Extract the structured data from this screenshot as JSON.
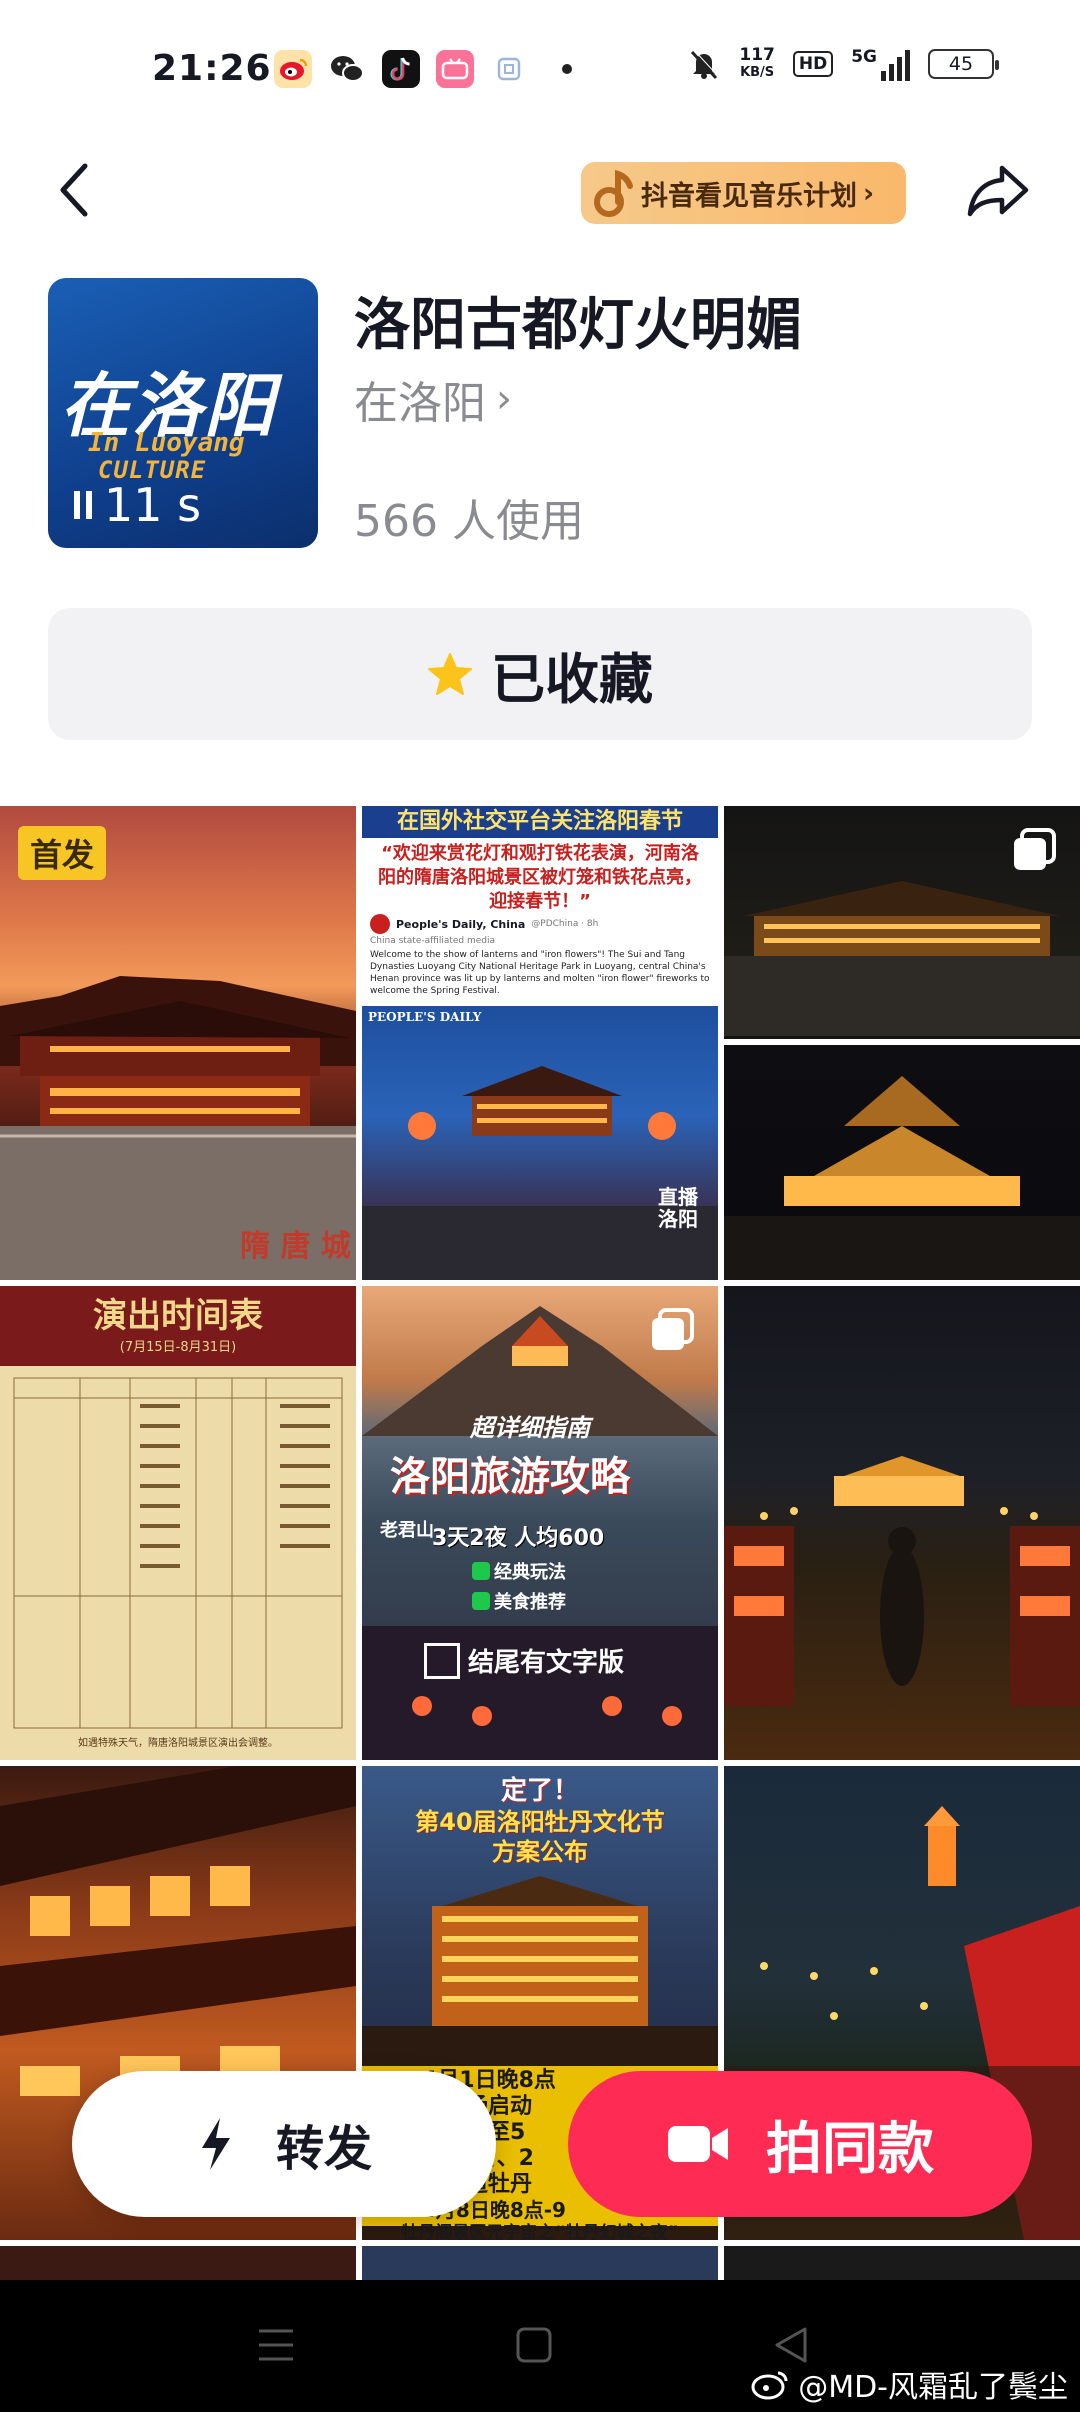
{
  "status_bar": {
    "time": "21:26",
    "net_speed_value": "117",
    "net_speed_unit": "KB/S",
    "hd_label": "HD",
    "network_label": "5G",
    "battery": "45",
    "apps": [
      "weibo-icon",
      "wechat-icon",
      "douyin-icon",
      "bilibili-icon",
      "generic-app-icon"
    ]
  },
  "header": {
    "back_icon": "chevron-left-icon",
    "promo_label": "抖音看见音乐计划",
    "promo_chevron": "›",
    "share_icon": "share-arrow-icon"
  },
  "effect": {
    "cover_main": "在洛阳",
    "cover_sub1": "In Luoyang",
    "cover_sub2": "CULTURE",
    "duration": "11 s",
    "title": "洛阳古都灯火明媚",
    "author": "在洛阳",
    "author_chevron": "›",
    "uses": "566 人使用"
  },
  "favorite": {
    "label": "已收藏",
    "icon": "star-icon",
    "star_color": "#fcc31b"
  },
  "grid": {
    "first_badge": "首发",
    "tiles": [
      {
        "overlay": ""
      },
      {
        "headline": "在国外社交平台关注洛阳春节",
        "quote": "“欢迎来赏花灯和观打铁花表演，河南洛阳的隋唐洛阳城景区被灯笼和铁花点亮，迎接春节！”",
        "source": "People's Daily, China",
        "handle": "@PDChina · 8h",
        "tag": "China state-affiliated media",
        "body": "Welcome to the show of lanterns and \"iron flowers\"! The Sui and Tang Dynasties Luoyang City National Heritage Park in Luoyang, central China's Henan province was lit up by lanterns and molten \"iron flower\" fireworks to welcome the Spring Festival.",
        "logo": "PEOPLE'S DAILY",
        "corner": "直播洛阳"
      },
      {
        "overlay": ""
      },
      {
        "headline": "演出时间表",
        "sub": "(7月15日-8月31日)",
        "footer": "如遇特殊天气，隋唐洛阳城景区演出会调整。"
      },
      {
        "label1": "超详细指南",
        "headline": "洛阳旅游攻略",
        "line1": "3天2夜 人均600",
        "line2": "经典玩法",
        "line3": "美食推荐",
        "line4": "结尾有文字版",
        "tag": "老君山"
      },
      {
        "overlay": ""
      },
      {
        "overlay": ""
      },
      {
        "headline1": "定了！",
        "headline2": "第40届洛阳牡丹文化节",
        "headline3": "方案公布",
        "line1": "4月1日晚8点",
        "line2": "北广场启动",
        "line3": "期持续至5",
        "line4": "4月1日、2",
        "line5": "色街道牡丹",
        "line6": "4月8日晚8点-9",
        "line7": "牡丹阁景区元宇宙之“牡丹幻城之夜”"
      },
      {
        "overlay": ""
      }
    ]
  },
  "actions": {
    "repost_label": "转发",
    "repost_icon": "lightning-icon",
    "shoot_label": "拍同款",
    "shoot_icon": "video-camera-icon",
    "accent": "#fe2c55"
  },
  "nav": {
    "menu_icon": "menu-icon",
    "home_icon": "home-square-icon",
    "back_icon": "back-triangle-icon",
    "watermark": "@MD-风霜乱了鬓尘"
  }
}
